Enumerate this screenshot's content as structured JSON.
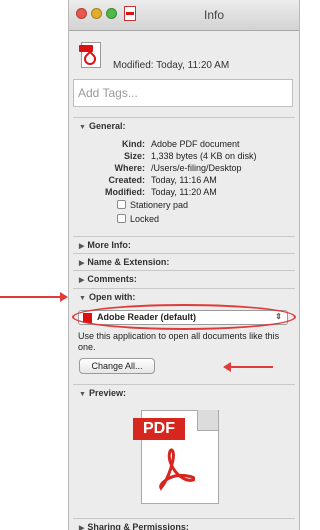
{
  "window": {
    "title": "Info"
  },
  "header": {
    "modified_line": "Modified: Today, 11:20 AM"
  },
  "tags": {
    "placeholder": "Add Tags..."
  },
  "general": {
    "heading": "General:",
    "rows": [
      {
        "key": "Kind:",
        "value": "Adobe PDF document"
      },
      {
        "key": "Size:",
        "value": "1,338 bytes (4 KB on disk)"
      },
      {
        "key": "Where:",
        "value": "/Users/e-filing/Desktop"
      },
      {
        "key": "Created:",
        "value": "Today, 11:16 AM"
      },
      {
        "key": "Modified:",
        "value": "Today, 11:20 AM"
      }
    ],
    "stationery_label": "Stationery pad",
    "locked_label": "Locked"
  },
  "sections": {
    "more_info": "More Info:",
    "name_extension": "Name & Extension:",
    "comments": "Comments:",
    "open_with": "Open with:",
    "preview": "Preview:",
    "sharing": "Sharing & Permissions:"
  },
  "open_with": {
    "selected_app": "Adobe Reader (default)",
    "hint": "Use this application to open all documents like this one.",
    "change_all_label": "Change All..."
  },
  "preview": {
    "badge_text": "PDF"
  },
  "colors": {
    "annotation_red": "#e03a3a",
    "pdf_red": "#d7261e"
  }
}
